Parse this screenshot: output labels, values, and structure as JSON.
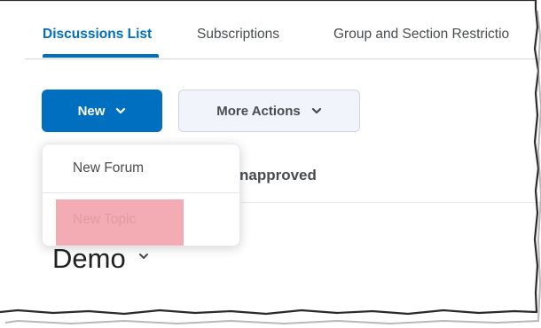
{
  "tabs": [
    {
      "label": "Discussions List",
      "active": true
    },
    {
      "label": "Subscriptions",
      "active": false
    },
    {
      "label": "Group and Section Restrictio",
      "active": false
    }
  ],
  "toolbar": {
    "new_label": "New",
    "more_actions_label": "More Actions"
  },
  "background": {
    "filter_label": "napproved",
    "forum_title": "Demo"
  },
  "dropdown": {
    "items": [
      {
        "label": "New Forum"
      },
      {
        "label": "New Topic",
        "highlighted": true
      }
    ]
  },
  "colors": {
    "accent": "#006fbf",
    "highlight": "#f2a3ab"
  },
  "icons": [
    "chevron-down-icon"
  ]
}
